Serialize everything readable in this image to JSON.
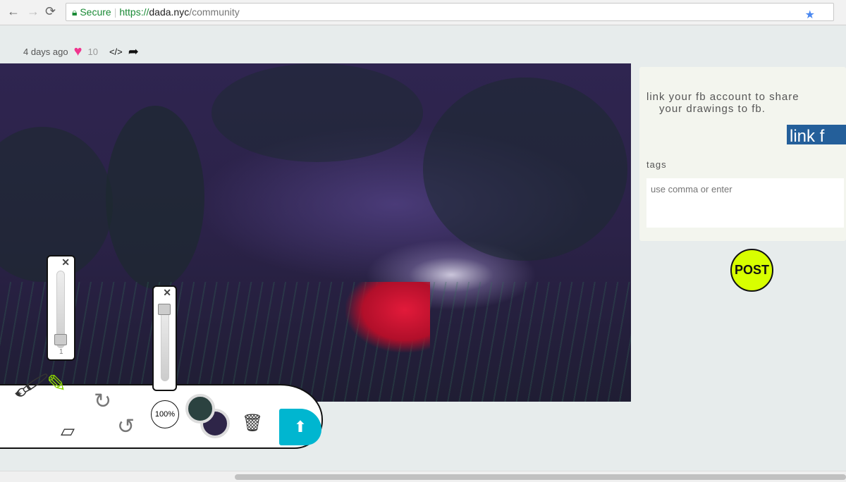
{
  "browser": {
    "secure_label": "Secure",
    "url_proto": "https://",
    "url_host": "dada.nyc",
    "url_path": "/community"
  },
  "post_meta": {
    "time": "4 days ago",
    "likes": "10",
    "embed_icon": "</>"
  },
  "tools": {
    "brush_size": "1",
    "zoom": "100%",
    "primary_color": "#2b4240",
    "secondary_color": "#2e2548"
  },
  "sidebar": {
    "fb_line1": "link your fb account to share",
    "fb_line2": "your drawings to fb.",
    "fb_button": "link f",
    "tags_label": "tags",
    "tags_placeholder": "use comma or enter",
    "post_button": "POST"
  },
  "colors": {
    "accent": "#00b6d0",
    "post": "#d8ff00",
    "fb": "#245f9a"
  }
}
